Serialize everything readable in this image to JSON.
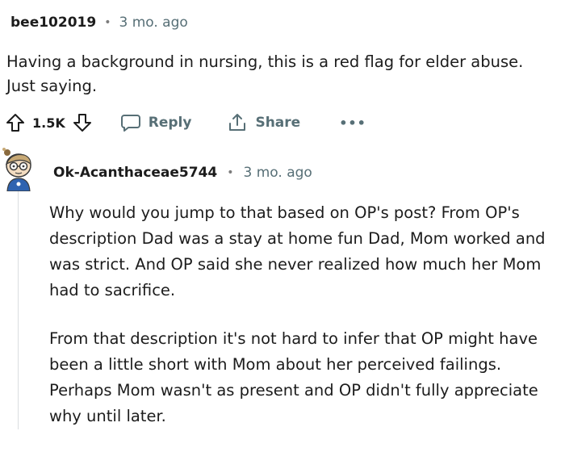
{
  "comment": {
    "username": "bee102019",
    "separator": "•",
    "time": "3 mo. ago",
    "body": "Having a background in nursing, this is a red flag for elder abuse. Just saying.",
    "score": "1.5K",
    "actions": {
      "reply_label": "Reply",
      "share_label": "Share",
      "more_label": "•••"
    }
  },
  "reply": {
    "username": "Ok-Acanthaceae5744",
    "separator": "•",
    "time": "3 mo. ago",
    "paragraphs": [
      "Why would you jump to that based on OP's post? From OP's description Dad was a stay at home fun Dad, Mom worked and was strict. And OP said she never realized how much her Mom had to sacrifice.",
      "From that description it's not hard to infer that OP might have been a little short with Mom about her perceived failings. Perhaps Mom wasn't as present and OP didn't fully appreciate why until later."
    ]
  },
  "icons": {
    "upvote": "arrow-up-icon",
    "downvote": "arrow-down-icon",
    "reply": "speech-bubble-icon",
    "share": "share-icon",
    "more": "ellipsis-icon",
    "avatar": "avatar-icon"
  },
  "colors": {
    "meta": "#576f76",
    "text": "#1c1c1c",
    "thread_line": "#dadde0"
  }
}
